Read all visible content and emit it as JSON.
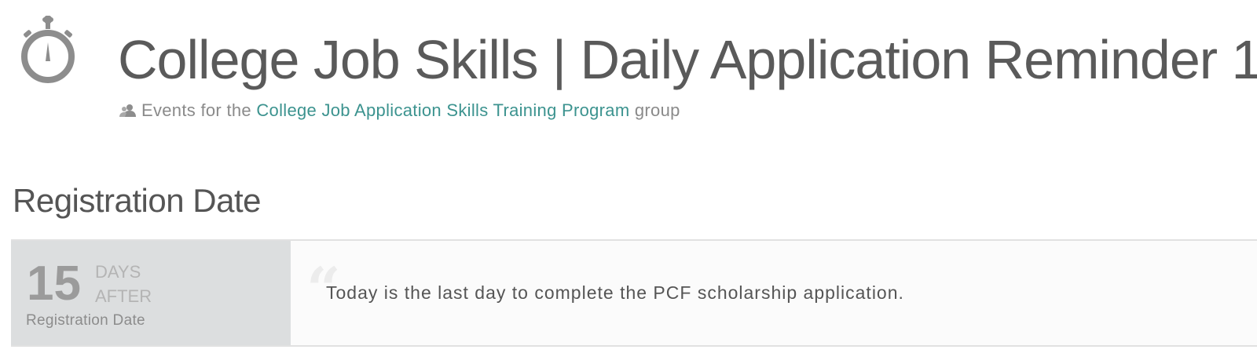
{
  "header": {
    "icon": "stopwatch-icon",
    "title": "College Job Skills | Daily Application Reminder 1",
    "subtitle": {
      "icon": "group-icon",
      "prefix": "Events for the ",
      "group_link": "College Job Application Skills Training Program",
      "suffix": " group"
    }
  },
  "section": {
    "heading": "Registration Date"
  },
  "event": {
    "offset_number": "15",
    "offset_unit": "DAYS",
    "offset_direction": "AFTER",
    "offset_reference": "Registration Date",
    "quote_icon": "quote-icon",
    "message": "Today is the last day to complete the PCF scholarship application."
  },
  "colors": {
    "link": "#3c938f",
    "offset_panel_bg": "#dcdedf",
    "title_text": "#5a5a5a"
  }
}
